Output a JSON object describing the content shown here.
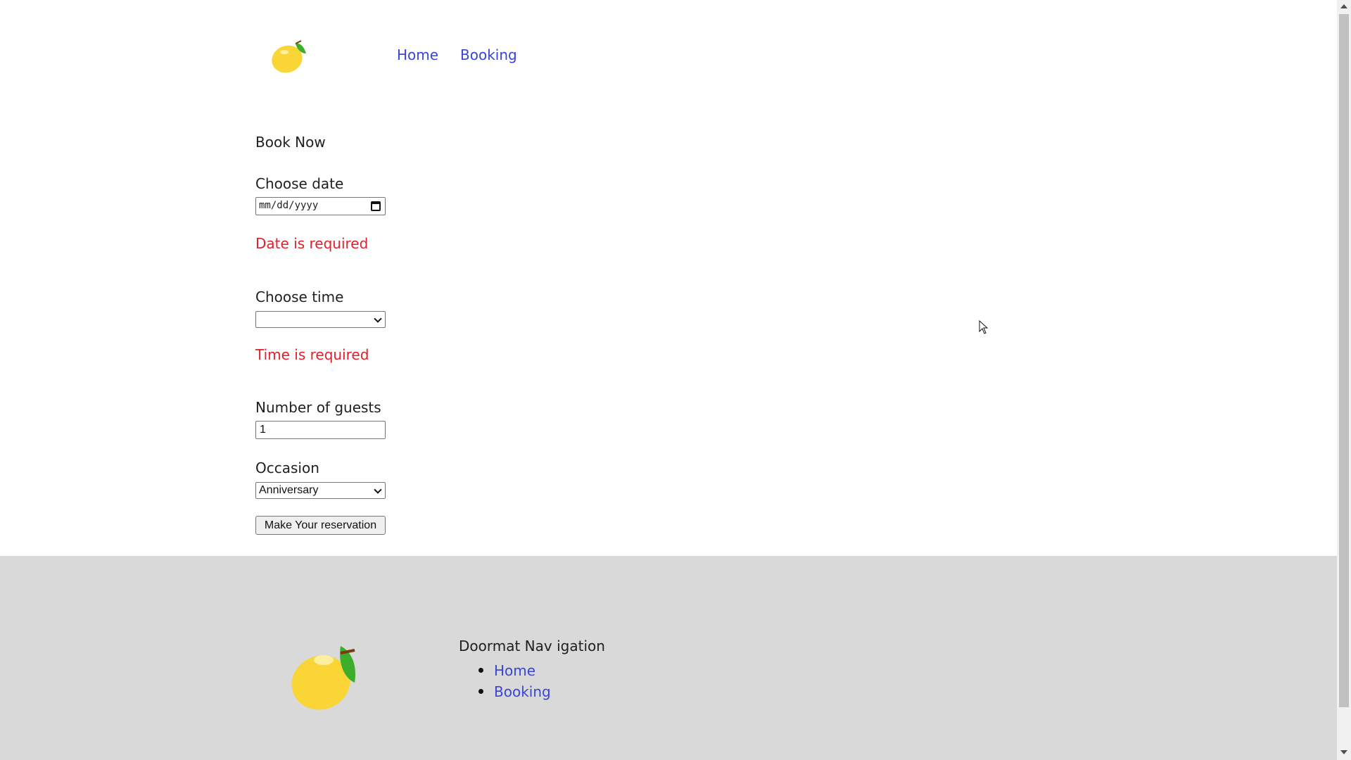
{
  "header": {
    "logo_icon": "lemon-icon",
    "nav": [
      {
        "label": "Home"
      },
      {
        "label": "Booking"
      }
    ]
  },
  "form": {
    "title": "Book Now",
    "date_label": "Choose date",
    "date_placeholder": "mm/dd/yyyy",
    "date_error": "Date is required",
    "time_label": "Choose time",
    "time_value": "",
    "time_error": "Time is required",
    "guests_label": "Number of guests",
    "guests_value": "1",
    "occasion_label": "Occasion",
    "occasion_value": "Anniversary",
    "submit_label": "Make Your reservation"
  },
  "footer": {
    "logo_icon": "lemon-icon",
    "doormat_title": "Doormat Nav igation",
    "links": [
      {
        "label": "Home"
      },
      {
        "label": "Booking"
      }
    ]
  },
  "colors": {
    "link": "#3a44d6",
    "error": "#e0202a",
    "footer_bg": "#d9d9d9",
    "lemon": "#f9d535",
    "leaf": "#3dae2b"
  }
}
